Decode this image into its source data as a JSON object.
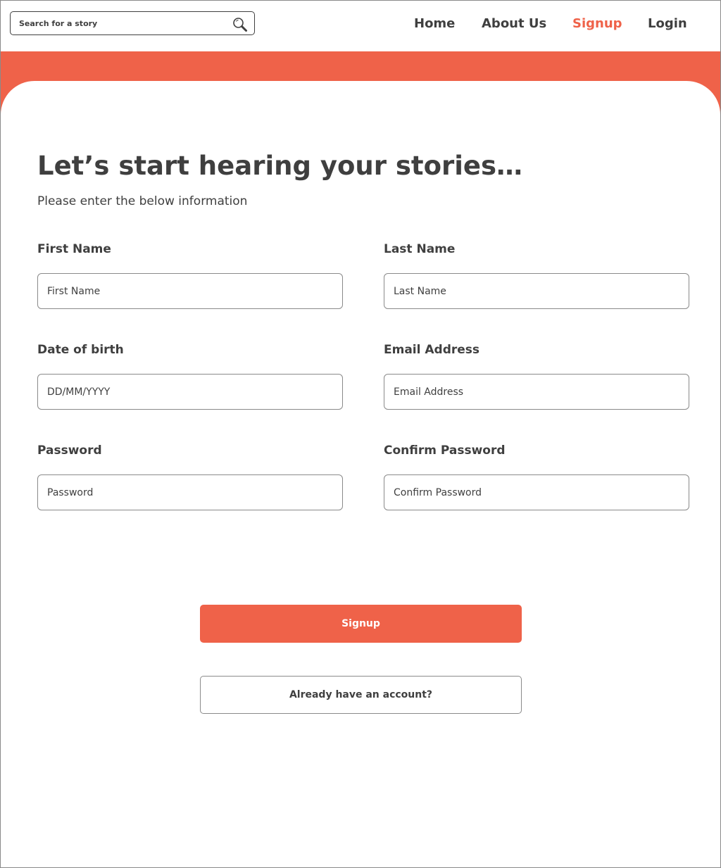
{
  "search": {
    "placeholder": "Search for a story",
    "icon": "search-icon"
  },
  "nav": {
    "items": [
      {
        "label": "Home"
      },
      {
        "label": "About Us"
      },
      {
        "label": "Signup"
      },
      {
        "label": "Login"
      }
    ],
    "active": "Signup"
  },
  "colors": {
    "accent": "#ef6249",
    "text": "#3f3f3f",
    "border": "#8a8a8a"
  },
  "form": {
    "title": "Let’s start hearing your stories…",
    "subtitle": "Please enter the below information",
    "fields": {
      "first_name": {
        "label": "First Name",
        "placeholder": "First Name"
      },
      "last_name": {
        "label": "Last Name",
        "placeholder": "Last Name"
      },
      "dob": {
        "label": "Date of birth",
        "placeholder": "DD/MM/YYYY"
      },
      "email": {
        "label": "Email Address",
        "placeholder": "Email Address"
      },
      "password": {
        "label": "Password",
        "placeholder": "Password"
      },
      "confirm_password": {
        "label": "Confirm Password",
        "placeholder": "Confirm Password"
      }
    },
    "signup_button": "Signup",
    "login_link": "Already have an account?"
  }
}
